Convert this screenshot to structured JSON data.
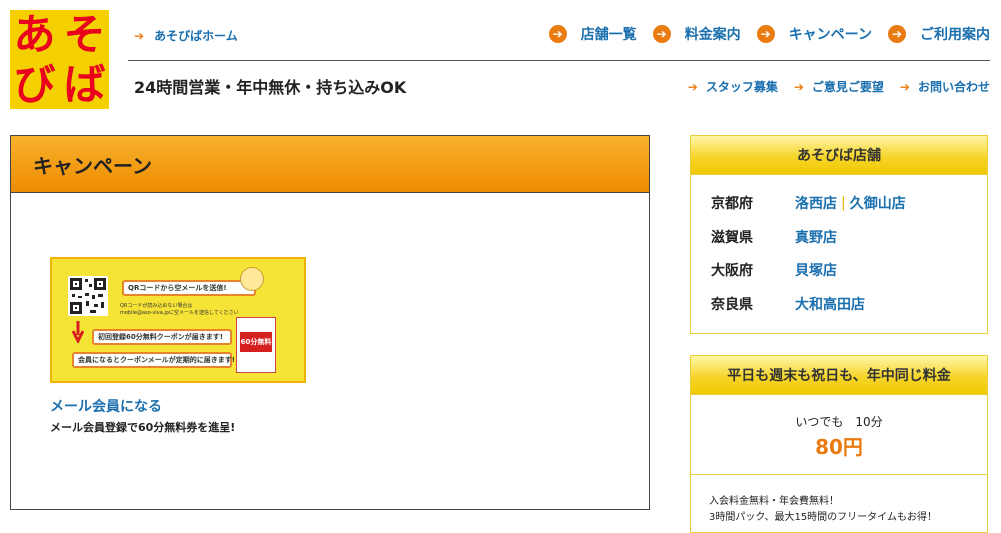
{
  "logo": {
    "chars": [
      "あ",
      "そ",
      "び",
      "ば"
    ]
  },
  "header": {
    "home_link": "あそびばホーム",
    "tagline": "24時間営業・年中無休・持ち込みOK",
    "nav_main": [
      "店舗一覧",
      "料金案内",
      "キャンペーン",
      "ご利用案内"
    ],
    "nav_sub": [
      "スタッフ募集",
      "ご意見ご要望",
      "お問い合わせ"
    ]
  },
  "main": {
    "title": "キャンペーン",
    "banner": {
      "line1": "QRコードから空メールを送信!",
      "note": "QRコードが読み込めない場合は\nmobile@aso-viva.jpに空メールを送信してください",
      "line2": "初回登録60分無料クーポンが届きます!",
      "line3": "会員になるとクーポンメールが定期的に届きます!",
      "coupon": "60分無料"
    },
    "member_link": "メール会員になる",
    "member_desc": "メール会員登録で60分無料券を進呈!"
  },
  "sidebar": {
    "stores_title": "あそびば店舗",
    "stores": [
      {
        "pref": "京都府",
        "shops": [
          "洛西店",
          "久御山店"
        ]
      },
      {
        "pref": "滋賀県",
        "shops": [
          "真野店"
        ]
      },
      {
        "pref": "大阪府",
        "shops": [
          "貝塚店"
        ]
      },
      {
        "pref": "奈良県",
        "shops": [
          "大和高田店"
        ]
      }
    ],
    "price_title": "平日も週末も祝日も、年中同じ料金",
    "price_sub": "いつでも　10分",
    "price_value": "80円",
    "price_note1": "入会料金無料・年会費無料！",
    "price_note2": "3時間パック、最大15時間のフリータイムもお得！"
  },
  "colors": {
    "accent": "#ea7b10",
    "link": "#1a6fae",
    "logo_bg": "#f5d000",
    "logo_text": "#e8001c"
  },
  "icons": {
    "nav_main": "circle-arrow-right-icon",
    "nav_sub": "arrow-right-icon"
  }
}
